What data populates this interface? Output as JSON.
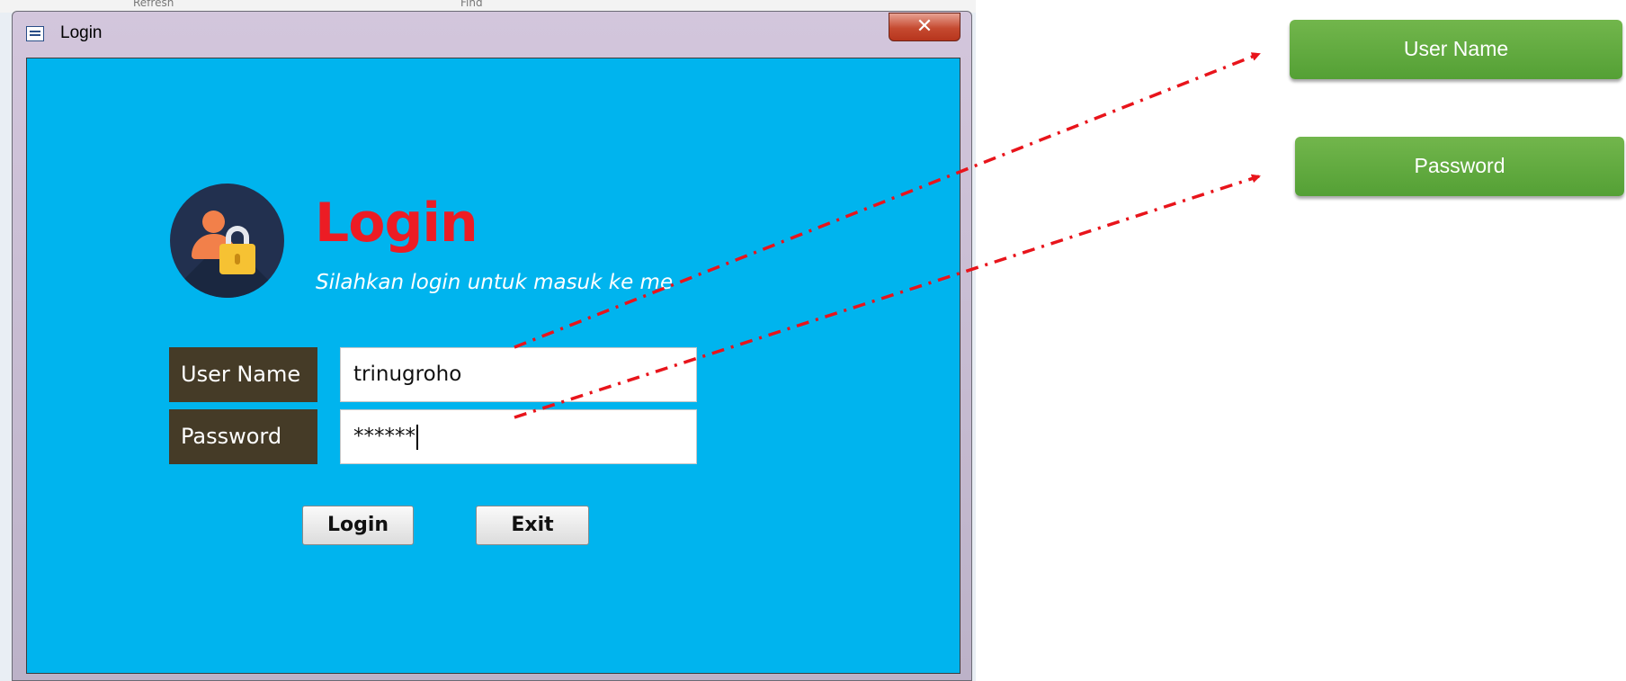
{
  "window": {
    "title": "Login",
    "close_label": "✕"
  },
  "background_ribbon": {
    "items": [
      "Refresh",
      "Find"
    ]
  },
  "login_form": {
    "heading": "Login",
    "subtitle": "Silahkan login untuk masuk ke me",
    "username_label": "User Name",
    "username_value": "trinugroho",
    "password_label": "Password",
    "password_value": "******",
    "login_button": "Login",
    "exit_button": "Exit"
  },
  "callouts": {
    "username": "User Name",
    "password": "Password"
  },
  "colors": {
    "content_bg": "#00b4ee",
    "heading": "#ec1c24",
    "label_bg": "#453b27",
    "callout": "#5eaa3d",
    "arrow": "#e8141b"
  },
  "icons": {
    "window": "form-icon",
    "logo": "user-lock-icon"
  }
}
